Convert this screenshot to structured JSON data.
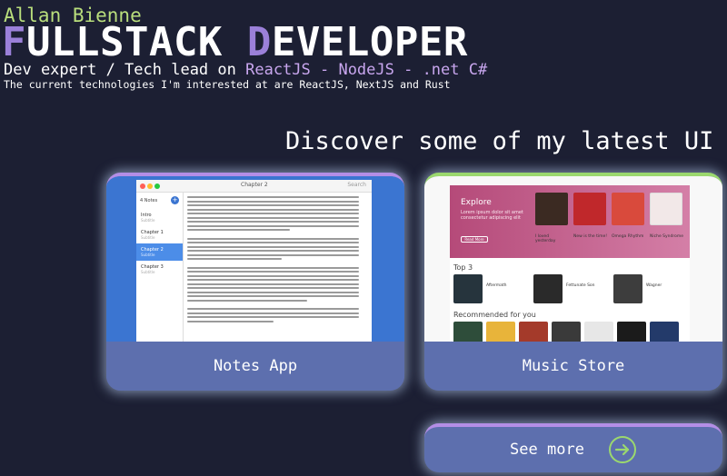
{
  "header": {
    "name": "Allan Bienne",
    "title_parts": [
      "F",
      "ULLSTACK ",
      "D",
      "EVELOPER"
    ],
    "subtitle_prefix": "Dev expert / Tech lead on ",
    "subtitle_tech": "ReactJS - NodeJS - .net C#",
    "interest": "The current technologies I'm interested at are ReactJS, NextJS and Rust"
  },
  "discover": "Discover some of my latest UI c",
  "projects": [
    {
      "label": "Notes App",
      "preview": {
        "window_title": "Chapter 2",
        "search": "Search",
        "count": "4 Notes",
        "items": [
          {
            "title": "Intro",
            "sub": "Subtitle"
          },
          {
            "title": "Chapter 1",
            "sub": "Subtitle"
          },
          {
            "title": "Chapter 2",
            "sub": "Subtitle"
          },
          {
            "title": "Chapter 3",
            "sub": "Subtitle"
          }
        ]
      }
    },
    {
      "label": "Music Store",
      "preview": {
        "hero_title": "Explore",
        "hero_text": "Lorem ipsum dolor sit amet consectetur adipiscing elit",
        "hero_button": "Read More",
        "top_heading": "Top 3",
        "recommended_heading": "Recommended for you",
        "albums": [
          {
            "name": "I loved yesterday"
          },
          {
            "name": "New is the time!"
          },
          {
            "name": "Omega Rhythm"
          },
          {
            "name": "Niche Syndrome"
          }
        ],
        "top": [
          {
            "name": "Aftermath"
          },
          {
            "name": "Fettunate Son"
          },
          {
            "name": "Wagner"
          }
        ]
      }
    }
  ],
  "see_more": {
    "label": "See more",
    "icon": "arrow-right-circle-icon"
  },
  "colors": {
    "background": "#1c1f33",
    "name": "#b9de7c",
    "accent": "#9b80d9",
    "card": "#5d6fae",
    "arrow": "#9bd86e"
  }
}
